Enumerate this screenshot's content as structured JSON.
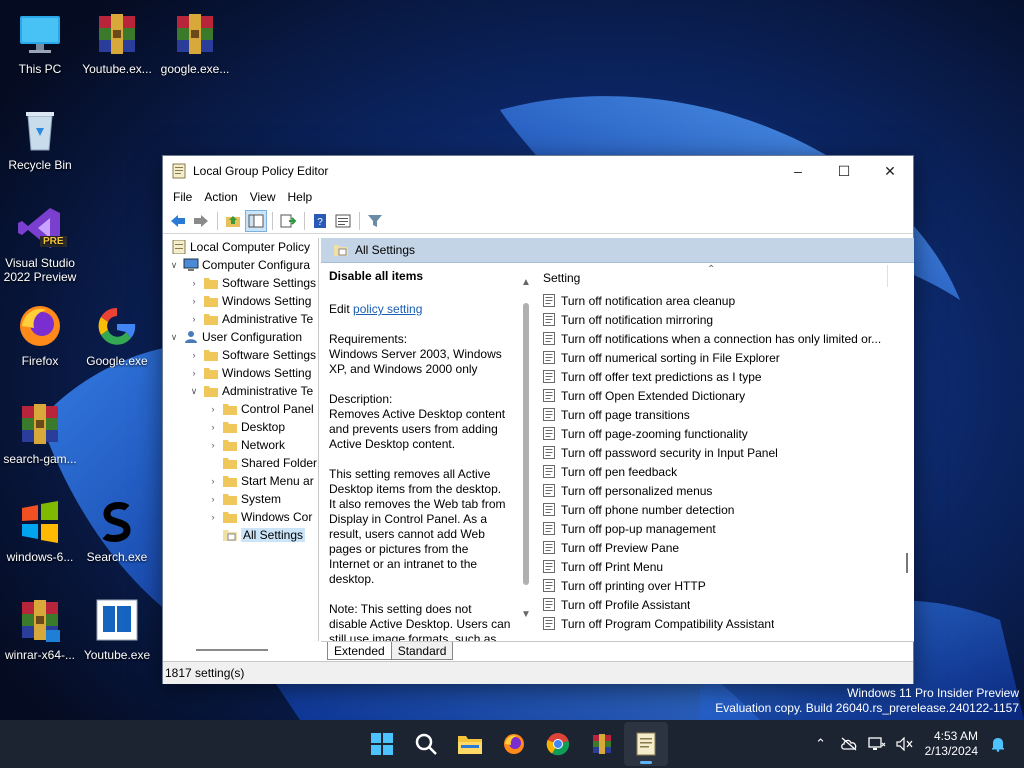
{
  "desktop": {
    "icons": [
      {
        "label": "This PC",
        "icon": "monitor-icon"
      },
      {
        "label": "Youtube.ex...",
        "icon": "winrar-icon"
      },
      {
        "label": "google.exe...",
        "icon": "winrar-icon"
      },
      {
        "label": "Recycle Bin",
        "icon": "recycle-bin-icon"
      },
      {
        "label": "Visual Studio 2022 Preview",
        "icon": "visual-studio-icon"
      },
      {
        "label": "Firefox",
        "icon": "firefox-icon"
      },
      {
        "label": "Google.exe",
        "icon": "google-icon"
      },
      {
        "label": "search-gam...",
        "icon": "winrar-icon"
      },
      {
        "label": "windows-6...",
        "icon": "windows-logo-icon"
      },
      {
        "label": "Search.exe",
        "icon": "s-letter-icon"
      },
      {
        "label": "winrar-x64-...",
        "icon": "winrar-icon"
      },
      {
        "label": "Youtube.exe",
        "icon": "notepad-icon"
      }
    ],
    "vs_badge": "PRE"
  },
  "window": {
    "title": "Local Group Policy Editor",
    "menu": [
      "File",
      "Action",
      "View",
      "Help"
    ],
    "tree": [
      {
        "label": "Local Computer Policy",
        "depth": 0,
        "chevron": "",
        "icon": "policy"
      },
      {
        "label": "Computer Configura",
        "depth": 1,
        "chevron": "open",
        "icon": "computer"
      },
      {
        "label": "Software Settings",
        "depth": 2,
        "chevron": "closed",
        "icon": "folder"
      },
      {
        "label": "Windows Setting",
        "depth": 2,
        "chevron": "closed",
        "icon": "folder"
      },
      {
        "label": "Administrative Te",
        "depth": 2,
        "chevron": "closed",
        "icon": "folder"
      },
      {
        "label": "User Configuration",
        "depth": 1,
        "chevron": "open",
        "icon": "user"
      },
      {
        "label": "Software Settings",
        "depth": 2,
        "chevron": "closed",
        "icon": "folder"
      },
      {
        "label": "Windows Setting",
        "depth": 2,
        "chevron": "closed",
        "icon": "folder"
      },
      {
        "label": "Administrative Te",
        "depth": 2,
        "chevron": "open",
        "icon": "folder"
      },
      {
        "label": "Control Panel",
        "depth": 3,
        "chevron": "closed",
        "icon": "folder"
      },
      {
        "label": "Desktop",
        "depth": 3,
        "chevron": "closed",
        "icon": "folder"
      },
      {
        "label": "Network",
        "depth": 3,
        "chevron": "closed",
        "icon": "folder"
      },
      {
        "label": "Shared Folder",
        "depth": 3,
        "chevron": "",
        "icon": "folder"
      },
      {
        "label": "Start Menu ar",
        "depth": 3,
        "chevron": "closed",
        "icon": "folder"
      },
      {
        "label": "System",
        "depth": 3,
        "chevron": "closed",
        "icon": "folder"
      },
      {
        "label": "Windows Cor",
        "depth": 3,
        "chevron": "closed",
        "icon": "folder"
      },
      {
        "label": "All Settings",
        "depth": 3,
        "chevron": "",
        "icon": "settings",
        "selected": true
      }
    ],
    "pane_header": "All Settings",
    "description": {
      "heading": "Disable all items",
      "edit_prefix": "Edit ",
      "edit_link": "policy setting",
      "requirements": "Requirements:\nWindows Server 2003, Windows XP, and Windows 2000 only",
      "desc": "Description:\nRemoves Active Desktop content and prevents users from adding Active Desktop content.",
      "body": "This setting removes all Active Desktop items from the desktop. It also removes the Web tab from Display in Control Panel. As a result, users cannot add Web pages or  pictures from the Internet or an intranet to the desktop.",
      "note": "Note: This setting does not disable Active Desktop. Users can  still use image formats, such as JPEG and"
    },
    "list_header": "Setting",
    "settings": [
      "Turn off notification area cleanup",
      "Turn off notification mirroring",
      "Turn off notifications when a connection has only limited or...",
      "Turn off numerical sorting in File Explorer",
      "Turn off offer text predictions as I type",
      "Turn off Open Extended Dictionary",
      "Turn off page transitions",
      "Turn off page-zooming functionality",
      "Turn off password security in Input Panel",
      "Turn off pen feedback",
      "Turn off personalized menus",
      "Turn off phone number detection",
      "Turn off pop-up management",
      "Turn off Preview Pane",
      "Turn off Print Menu",
      "Turn off printing over HTTP",
      "Turn off Profile Assistant",
      "Turn off Program Compatibility Assistant"
    ],
    "tabs": [
      "Extended",
      "Standard"
    ],
    "status": "1817 setting(s)"
  },
  "watermark": {
    "line1": "Windows 11 Pro Insider Preview",
    "line2": "Evaluation copy. Build 26040.rs_prerelease.240122-1157"
  },
  "taskbar": {
    "apps": [
      "start-icon",
      "search-icon",
      "file-explorer-icon",
      "firefox-icon",
      "chrome-icon",
      "winrar-icon",
      "notepad-icon"
    ],
    "time": "4:53 AM",
    "date": "2/13/2024"
  },
  "colors": {
    "accent": "#0078d4",
    "pane_header": "#c3d4e6",
    "selection": "#cce4f7",
    "taskbar": "#1c2331"
  }
}
